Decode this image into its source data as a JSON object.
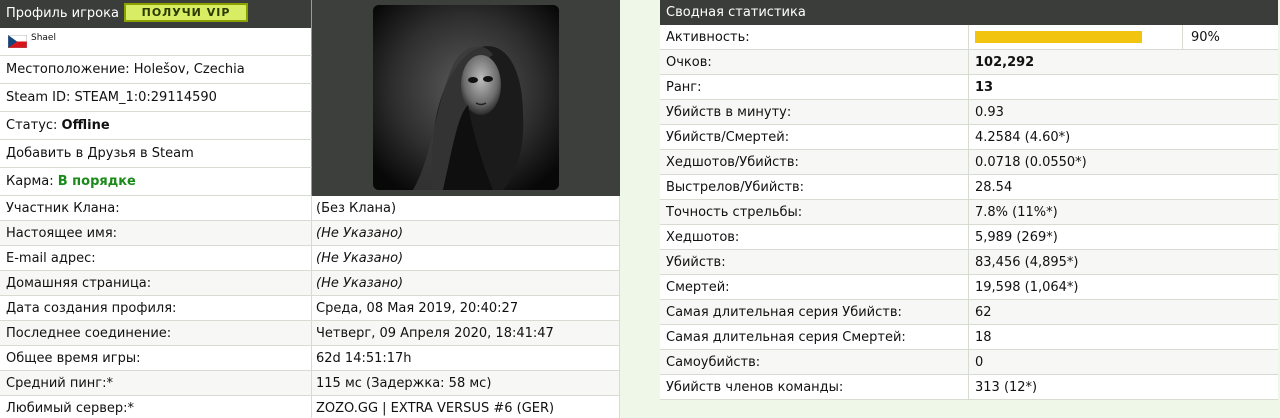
{
  "profile": {
    "header_title": "Профиль игрока",
    "vip_button": "ПОЛУЧИ VIP",
    "nickname": "Shael",
    "location": "Местоположение: Holešov, Czechia",
    "steam_id": "Steam ID: STEAM_1:0:29114590",
    "status_label": "Статус: ",
    "status_value": "Offline",
    "add_friend": "Добавить в Друзья в Steam",
    "karma_label": "Карма: ",
    "karma_value": "В порядке"
  },
  "details": [
    {
      "label": "Участник Клана:",
      "value": "(Без Клана)"
    },
    {
      "label": "Настоящее имя:",
      "value": "(Не Указано)"
    },
    {
      "label": "E-mail адрес:",
      "value": "(Не Указано)"
    },
    {
      "label": "Домашняя страница:",
      "value": "(Не Указано)"
    },
    {
      "label": "Дата создания профиля:",
      "value": "Среда, 08 Мая 2019, 20:40:27"
    },
    {
      "label": "Последнее соединение:",
      "value": "Четверг, 09 Апреля 2020, 18:41:47"
    },
    {
      "label": "Общее время игры:",
      "value": "62d 14:51:17h"
    },
    {
      "label": "Средний пинг:*",
      "value": "115 мс (Задержка: 58 мс)"
    },
    {
      "label": "Любимый сервер:*",
      "value": "ZOZO.GG | EXTRA VERSUS #6 (GER)"
    }
  ],
  "stats": {
    "header": "Сводная статистика",
    "activity_label": "Активность:",
    "activity_percent": "90%",
    "activity_fraction": 0.9,
    "rows": [
      {
        "label": "Очков:",
        "value": "102,292"
      },
      {
        "label": "Ранг:",
        "value": "13"
      },
      {
        "label": "Убийств в минуту:",
        "value": "0.93"
      },
      {
        "label": "Убийств/Смертей:",
        "value": "4.2584 (4.60*)"
      },
      {
        "label": "Хедшотов/Убийств:",
        "value": "0.0718 (0.0550*)"
      },
      {
        "label": "Выстрелов/Убийств:",
        "value": "28.54"
      },
      {
        "label": "Точность стрельбы:",
        "value": "7.8% (11%*)"
      },
      {
        "label": "Хедшотов:",
        "value": "5,989 (269*)"
      },
      {
        "label": "Убийств:",
        "value": "83,456 (4,895*)"
      },
      {
        "label": "Смертей:",
        "value": "19,598 (1,064*)"
      },
      {
        "label": "Самая длительная серия Убийств:",
        "value": "62"
      },
      {
        "label": "Самая длительная серия Смертей:",
        "value": "18"
      },
      {
        "label": "Самоубийств:",
        "value": "0"
      },
      {
        "label": "Убийств членов команды:",
        "value": "313 (12*)"
      }
    ]
  },
  "colors": {
    "header_bg": "#3b3d3b",
    "vip_bg": "#d8ec64",
    "activity_bar": "#f1c40f",
    "karma_green": "#1a8a1a"
  }
}
